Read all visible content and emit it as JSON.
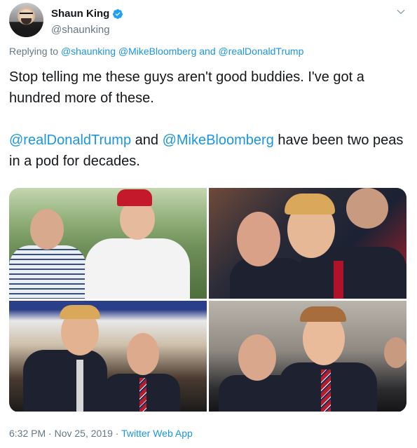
{
  "user": {
    "display_name": "Shaun King",
    "handle": "@shaunking",
    "verified": true,
    "avatar_icon": "profile-photo"
  },
  "reply": {
    "prefix": "Replying to",
    "mentions": [
      "@shaunking",
      "@MikeBloomberg",
      "and",
      "@realDonaldTrump"
    ]
  },
  "tweet": {
    "line1": "Stop telling me these guys aren't good buddies. I've got a hundred more of these.",
    "mention_a": "@realDonaldTrump",
    "connector": " and ",
    "mention_b": "@MikeBloomberg",
    "rest": " have been two peas in a pod for decades."
  },
  "media": {
    "photo_count": 4
  },
  "footer": {
    "time": "6:32 PM",
    "separator": "·",
    "date": "Nov 25, 2019",
    "source": "Twitter Web App"
  },
  "colors": {
    "link": "#1b95e0",
    "text": "#14171a",
    "muted": "#657786",
    "verified": "#1da1f2"
  }
}
